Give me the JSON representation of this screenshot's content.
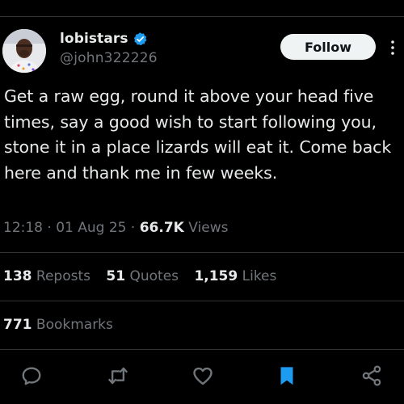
{
  "author": {
    "display_name": "lobistars",
    "handle": "@john322226",
    "verified": true
  },
  "follow_button": {
    "label": "Follow"
  },
  "tweet": {
    "text": "Get a raw egg, round it above your head five times, say a good wish to start following you, stone it in a place lizards will eat it. Come back here and thank me in few weeks.",
    "time": "12:18",
    "separator": "·",
    "date": "01 Aug 25",
    "views_count": "66.7K",
    "views_label": "Views"
  },
  "stats": {
    "reposts": {
      "count": "138",
      "label": "Reposts"
    },
    "quotes": {
      "count": "51",
      "label": "Quotes"
    },
    "likes": {
      "count": "1,159",
      "label": "Likes"
    },
    "bookmarks": {
      "count": "771",
      "label": "Bookmarks"
    }
  },
  "actions": [
    "reply-icon",
    "repost-icon",
    "like-icon",
    "bookmark-icon",
    "share-icon"
  ],
  "colors": {
    "background": "#000000",
    "text": "#e7e9ea",
    "secondary_text": "#71767b",
    "divider": "#2f3336",
    "verified_blue": "#1d9bf0",
    "bookmark_active": "#1d9bf0",
    "follow_bg": "#eff3f4"
  }
}
